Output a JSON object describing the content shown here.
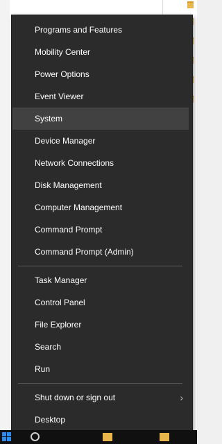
{
  "menu": {
    "items": [
      {
        "label": "Programs and Features"
      },
      {
        "label": "Mobility Center"
      },
      {
        "label": "Power Options"
      },
      {
        "label": "Event Viewer"
      },
      {
        "label": "System"
      },
      {
        "label": "Device Manager"
      },
      {
        "label": "Network Connections"
      },
      {
        "label": "Disk Management"
      },
      {
        "label": "Computer Management"
      },
      {
        "label": "Command Prompt"
      },
      {
        "label": "Command Prompt (Admin)"
      },
      {
        "label": "Task Manager"
      },
      {
        "label": "Control Panel"
      },
      {
        "label": "File Explorer"
      },
      {
        "label": "Search"
      },
      {
        "label": "Run"
      },
      {
        "label": "Shut down or sign out"
      },
      {
        "label": "Desktop"
      }
    ],
    "hovered_item": "System",
    "submenu_icon": "chevron-right-icon"
  },
  "colors": {
    "menu_bg": "#2b2b2b",
    "hover_bg": "#414141",
    "text": "#ffffff",
    "start_accent": "#2d8cf0"
  }
}
